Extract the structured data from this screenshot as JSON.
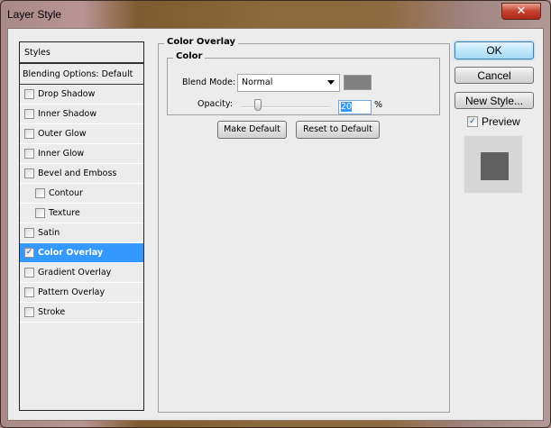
{
  "window": {
    "title": "Layer Style",
    "close": "✕"
  },
  "sidebar": {
    "header": "Styles",
    "blending": "Blending Options: Default",
    "items": [
      {
        "label": "Drop Shadow",
        "checked": false
      },
      {
        "label": "Inner Shadow",
        "checked": false
      },
      {
        "label": "Outer Glow",
        "checked": false
      },
      {
        "label": "Inner Glow",
        "checked": false
      },
      {
        "label": "Bevel and Emboss",
        "checked": false
      },
      {
        "label": "Contour",
        "checked": false
      },
      {
        "label": "Texture",
        "checked": false
      },
      {
        "label": "Satin",
        "checked": false
      },
      {
        "label": "Color Overlay",
        "checked": true
      },
      {
        "label": "Gradient Overlay",
        "checked": false
      },
      {
        "label": "Pattern Overlay",
        "checked": false
      },
      {
        "label": "Stroke",
        "checked": false
      }
    ]
  },
  "panel": {
    "title": "Color Overlay",
    "section": "Color",
    "blend_mode_label": "Blend Mode:",
    "blend_mode": "Normal",
    "color": "#808080",
    "opacity_label": "Opacity:",
    "opacity": "20",
    "percent": "%",
    "make_default": "Make Default",
    "reset_default": "Reset to Default"
  },
  "buttons": {
    "ok": "OK",
    "cancel": "Cancel",
    "new_style": "New Style...",
    "preview": "Preview",
    "check": "✓"
  }
}
